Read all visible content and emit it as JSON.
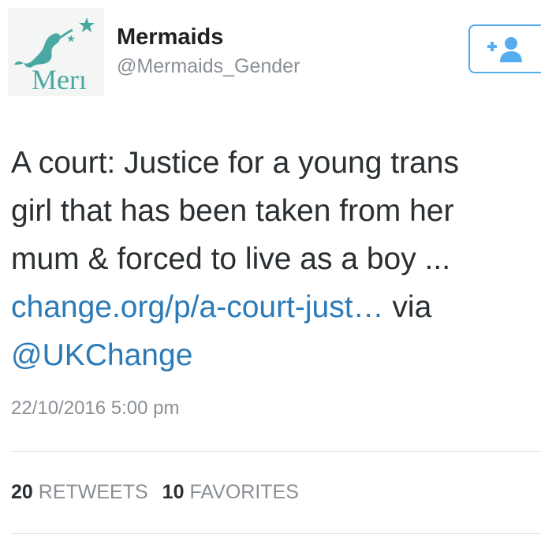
{
  "user": {
    "display_name": "Mermaids",
    "handle": "@Mermaids_Gender",
    "avatar_text": "Merı"
  },
  "follow_button": {
    "icon": "add-user-icon",
    "color": "#55acee"
  },
  "tweet": {
    "lines": [
      "A court: Justice for a young trans",
      "girl that has been taken from her",
      "mum & forced to live as a boy ..."
    ],
    "link_text": "change.org/p/a-court-just…",
    "via_text": " via",
    "mention": "@UKChange",
    "timestamp": "22/10/2016 5:00 pm"
  },
  "stats": {
    "retweets_count": "20",
    "retweets_label": "RETWEETS",
    "favorites_count": "10",
    "favorites_label": "FAVORITES"
  },
  "colors": {
    "link": "#2b7bb9",
    "brand_teal": "#4aa8a2",
    "muted": "#8a9096"
  }
}
